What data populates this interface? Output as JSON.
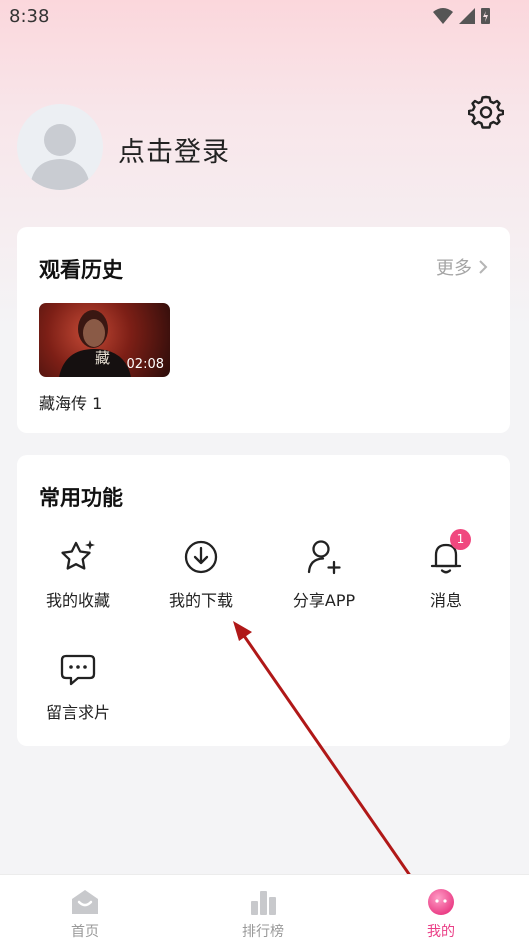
{
  "status_bar": {
    "time": "8:38"
  },
  "profile": {
    "login_text": "点击登录"
  },
  "history": {
    "title": "观看历史",
    "more_label": "更多",
    "items": [
      {
        "title": "藏海传 1",
        "duration": "02:08",
        "thumb_mark": "藏"
      }
    ]
  },
  "functions": {
    "title": "常用功能",
    "items": [
      {
        "label": "我的收藏",
        "icon": "star-sparkle-icon"
      },
      {
        "label": "我的下载",
        "icon": "download-icon"
      },
      {
        "label": "分享APP",
        "icon": "add-user-icon"
      },
      {
        "label": "消息",
        "icon": "bell-icon",
        "badge": "1"
      },
      {
        "label": "留言求片",
        "icon": "chat-bubble-icon"
      }
    ]
  },
  "tabbar": {
    "items": [
      {
        "label": "首页",
        "icon": "home-icon",
        "active": false
      },
      {
        "label": "排行榜",
        "icon": "bar-chart-icon",
        "active": false
      },
      {
        "label": "我的",
        "icon": "profile-face-icon",
        "active": true
      }
    ]
  },
  "colors": {
    "accent": "#ea3e86",
    "badge": "#f0487f",
    "annotation_arrow": "#b01818"
  }
}
